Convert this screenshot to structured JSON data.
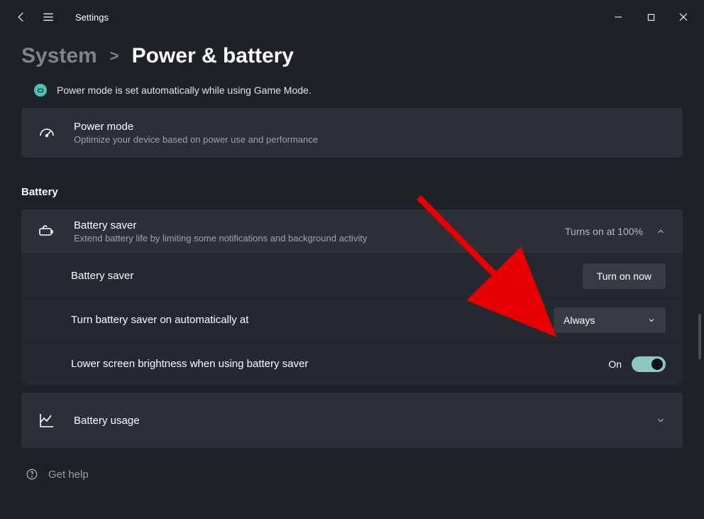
{
  "window": {
    "title": "Settings"
  },
  "breadcrumb": {
    "level1": "System",
    "separator": ">",
    "level2": "Power & battery"
  },
  "notice": {
    "text": "Power mode is set automatically while using Game Mode."
  },
  "power_mode": {
    "title": "Power mode",
    "subtitle": "Optimize your device based on power use and performance"
  },
  "battery_section": {
    "heading": "Battery",
    "saver": {
      "title": "Battery saver",
      "subtitle": "Extend battery life by limiting some notifications and background activity",
      "state_text": "Turns on at 100%",
      "sub_label": "Battery saver",
      "action_btn": "Turn on now",
      "automatic_label": "Turn battery saver on automatically at",
      "automatic_value": "Always",
      "brightness_label": "Lower screen brightness when using battery saver",
      "toggle_state": "On"
    },
    "usage": {
      "title": "Battery usage"
    }
  },
  "help": {
    "label": "Get help"
  },
  "colors": {
    "accent": "#8dc7c0",
    "arrow": "#e40000"
  }
}
